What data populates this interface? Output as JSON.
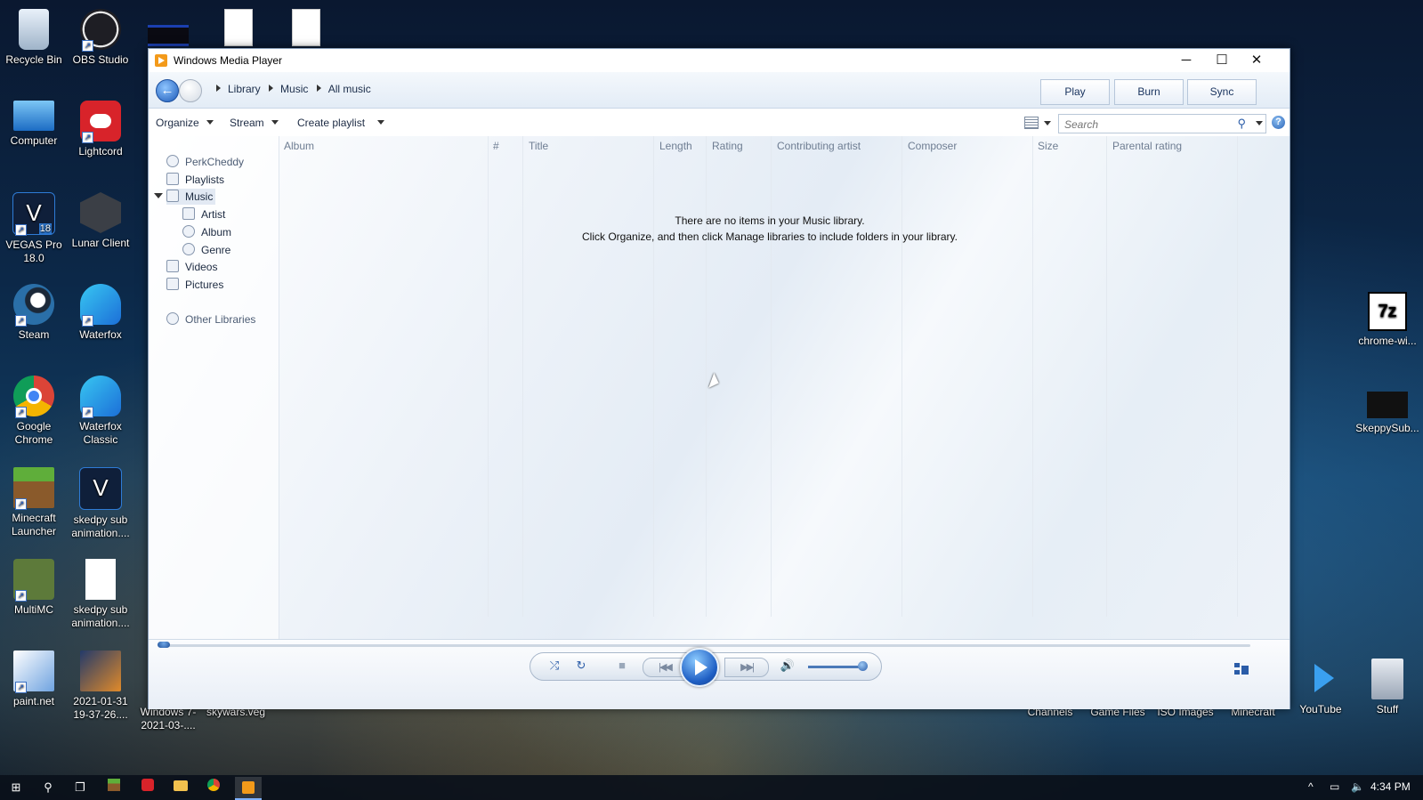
{
  "desktop": {
    "left_icons": [
      {
        "label": "Recycle Bin"
      },
      {
        "label": "OBS Studio"
      },
      {
        "label": "Computer"
      },
      {
        "label": "Lightcord"
      },
      {
        "label": "VEGAS Pro 18.0"
      },
      {
        "label": "Lunar Client"
      },
      {
        "label": "Steam"
      },
      {
        "label": "Waterfox"
      },
      {
        "label": "Google Chrome"
      },
      {
        "label": "Waterfox Classic"
      },
      {
        "label": "Minecraft Launcher"
      },
      {
        "label": "skedpy sub animation...."
      },
      {
        "label": "MultiMC"
      },
      {
        "label": "skedpy sub animation...."
      },
      {
        "label": "paint.net"
      },
      {
        "label": "2021-01-31 19-37-26...."
      }
    ],
    "bottom_icons": [
      {
        "label": "Windows 7-2021-03-...."
      },
      {
        "label": "skywars.veg"
      }
    ],
    "right_icons": [
      {
        "label": "chrome-wi..."
      },
      {
        "label": "SkeppySub..."
      },
      {
        "label": "Channels"
      },
      {
        "label": "Game Files"
      },
      {
        "label": "ISO Images"
      },
      {
        "label": "Minecraft"
      },
      {
        "label": "YouTube"
      },
      {
        "label": "Stuff"
      }
    ],
    "vegas_badge": "18",
    "sevenzip_text": "7z"
  },
  "window": {
    "title": "Windows Media Player",
    "controls": {
      "minimize": "─",
      "maximize": "☐",
      "close": "✕"
    }
  },
  "nav": {
    "breadcrumb": [
      "Library",
      "Music",
      "All music"
    ],
    "tabs": [
      "Play",
      "Burn",
      "Sync"
    ]
  },
  "toolbar": {
    "organize": "Organize",
    "stream": "Stream",
    "create_playlist": "Create playlist",
    "search_placeholder": "Search",
    "help": "?"
  },
  "library_tree": {
    "user": "PerkCheddy",
    "playlists": "Playlists",
    "music": "Music",
    "artist": "Artist",
    "album": "Album",
    "genre": "Genre",
    "videos": "Videos",
    "pictures": "Pictures",
    "other_libraries": "Other Libraries"
  },
  "columns": [
    "Album",
    "#",
    "Title",
    "Length",
    "Rating",
    "Contributing artist",
    "Composer",
    "Size",
    "Parental rating"
  ],
  "empty_message": {
    "line1": "There are no items in your Music library.",
    "line2": "Click Organize, and then click Manage libraries to include folders in your library."
  },
  "player": {
    "seek_progress": 0.0,
    "volume_level": 0.95,
    "prev_label": "|◀◀",
    "next_label": "▶▶|"
  },
  "taskbar": {
    "time": "4:34 PM"
  },
  "colors": {
    "accent": "#2a5ca8",
    "window_bg": "#ffffff",
    "app_icon": "#f39a1a"
  }
}
